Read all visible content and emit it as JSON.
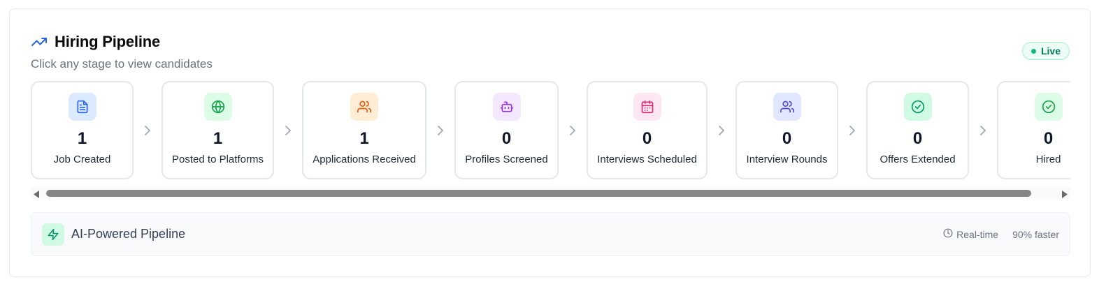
{
  "header": {
    "title": "Hiring Pipeline",
    "subtitle": "Click any stage to view candidates",
    "live_label": "Live"
  },
  "stages": [
    {
      "count": "1",
      "label": "Job Created",
      "icon": "document-icon",
      "icon_bg": "#dbeafe",
      "icon_color": "#2563eb"
    },
    {
      "count": "1",
      "label": "Posted to Platforms",
      "icon": "globe-icon",
      "icon_bg": "#dcfce7",
      "icon_color": "#16a34a"
    },
    {
      "count": "1",
      "label": "Applications Received",
      "icon": "users-icon",
      "icon_bg": "#ffedd5",
      "icon_color": "#ea580c"
    },
    {
      "count": "0",
      "label": "Profiles Screened",
      "icon": "bot-icon",
      "icon_bg": "#f3e8ff",
      "icon_color": "#9333ea"
    },
    {
      "count": "0",
      "label": "Interviews Scheduled",
      "icon": "calendar-icon",
      "icon_bg": "#fce7f3",
      "icon_color": "#db2777"
    },
    {
      "count": "0",
      "label": "Interview Rounds",
      "icon": "users-icon",
      "icon_bg": "#e0e7ff",
      "icon_color": "#4f46e5"
    },
    {
      "count": "0",
      "label": "Offers Extended",
      "icon": "check-circle-icon",
      "icon_bg": "#d1fae5",
      "icon_color": "#059669"
    },
    {
      "count": "0",
      "label": "Hired",
      "icon": "check-circle-icon",
      "icon_bg": "#dcfce7",
      "icon_color": "#16a34a"
    }
  ],
  "footer": {
    "title": "AI-Powered Pipeline",
    "realtime_label": "Real-time",
    "speed_label": "90% faster"
  },
  "colors": {
    "accent": "#2563eb",
    "live": "#047857"
  }
}
